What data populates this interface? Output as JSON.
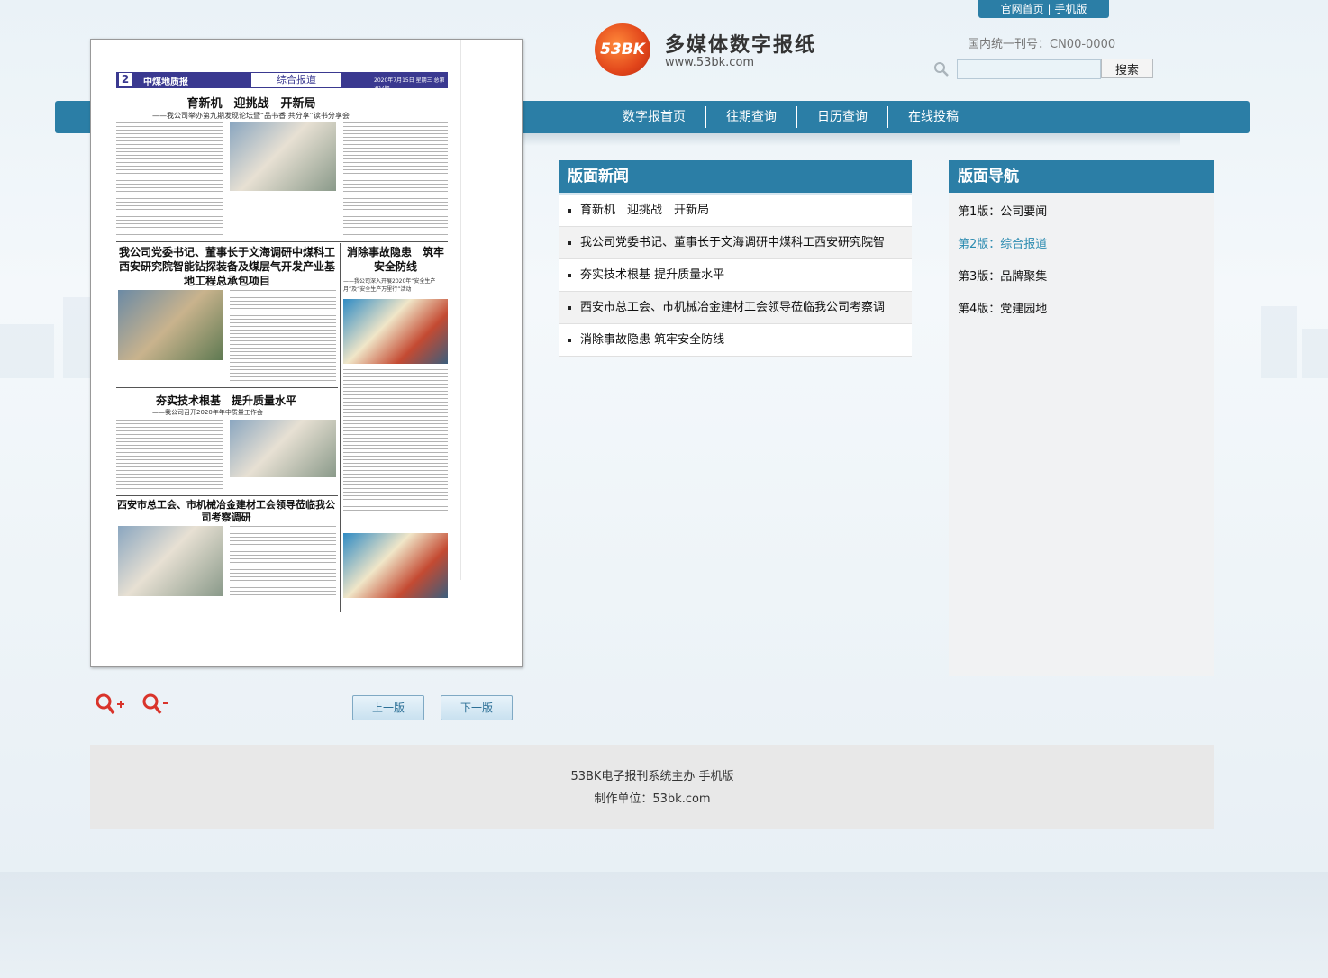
{
  "top_links": [
    "官网首页",
    "手机版"
  ],
  "logo": {
    "badge": "53BK",
    "title": "多媒体数字报纸",
    "url": "www.53bk.com"
  },
  "issn": "国内统一刊号：CN00-0000",
  "search": {
    "placeholder": "",
    "button": "搜索"
  },
  "nav": [
    "数字报首页",
    "往期查询",
    "日历查询",
    "在线投稿"
  ],
  "newspaper": {
    "page_no": "2",
    "masthead": "中煤地质报",
    "section": "综合报道",
    "date_line": "2020年7月15日 星期三 总第307期",
    "headline_1": "育新机　迎挑战　开新局",
    "subhead_1": "——我公司举办第九期发现论坛暨“品书香·共分享”读书分享会",
    "headline_2": "我公司党委书记、董事长于文海调研中煤科工西安研究院智能钻探装备及煤层气开发产业基地工程总承包项目",
    "headline_3": "消除事故隐患　筑牢安全防线",
    "subhead_3": "——我公司深入开展2020年“安全生产月”及“安全生产万里行”活动",
    "headline_4": "夯实技术根基　提升质量水平",
    "subhead_4": "——我公司召开2020年年中质量工作会",
    "headline_5": "西安市总工会、市机械冶金建材工会领导莅临我公司考察调研"
  },
  "pager": {
    "prev": "上一版",
    "next": "下一版"
  },
  "news_panel": {
    "title": "版面新闻",
    "items": [
      "育新机　迎挑战　开新局",
      "我公司党委书记、董事长于文海调研中煤科工西安研究院智",
      "夯实技术根基 提升质量水平",
      "西安市总工会、市机械冶金建材工会领导莅临我公司考察调",
      "消除事故隐患 筑牢安全防线"
    ]
  },
  "nav_panel": {
    "title": "版面导航",
    "items": [
      "第1版：公司要闻",
      "第2版：综合报道",
      "第3版：品牌聚集",
      "第4版：党建园地"
    ],
    "active_index": 1
  },
  "footer": {
    "line1": "53BK电子报刊系统主办 手机版",
    "line2": "制作单位：53bk.com"
  },
  "colors": {
    "primary": "#2b7ea6",
    "active_link": "#2b8bb0"
  }
}
